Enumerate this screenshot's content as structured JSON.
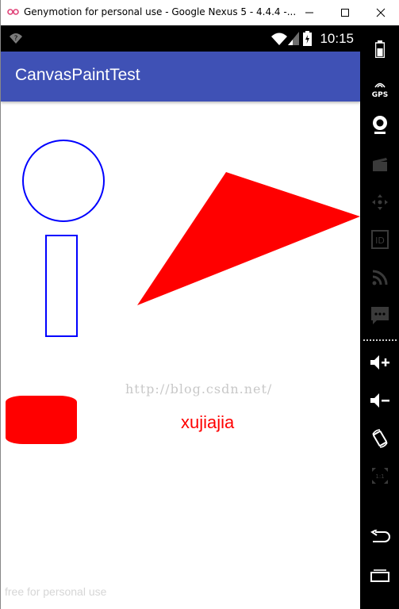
{
  "window": {
    "title": "Genymotion for personal use - Google Nexus 5 - 4.4.4 -...",
    "app_icon": "genymotion-logo-icon",
    "controls": [
      "minimize-icon",
      "maximize-icon",
      "close-icon"
    ]
  },
  "statusbar": {
    "time": "10:15",
    "icons": [
      "unknown-signal-icon",
      "wifi-icon",
      "cell-signal-icon",
      "battery-icon"
    ]
  },
  "actionbar": {
    "title": "CanvasPaintTest",
    "color": "#3f51b5"
  },
  "canvas": {
    "text_drawn": "xujiajia",
    "blog_watermark": "http://blog.csdn.net/",
    "shapes": [
      "circle-outline",
      "rectangle-outline",
      "triangle-filled",
      "rounded-rect-filled"
    ],
    "stroke_color": "#0000ff",
    "fill_color": "#ff0000"
  },
  "footer": {
    "watermark": "free for personal use"
  },
  "sidebar": {
    "gps_label": "GPS",
    "buttons": [
      "battery-icon",
      "gps-icon",
      "camera-icon",
      "video-capture-icon",
      "dpad-icon",
      "device-id-icon",
      "rss-icon",
      "sms-icon",
      "volume-up-icon",
      "volume-down-icon",
      "rotate-icon",
      "scale-icon",
      "back-icon",
      "recent-apps-icon"
    ]
  }
}
